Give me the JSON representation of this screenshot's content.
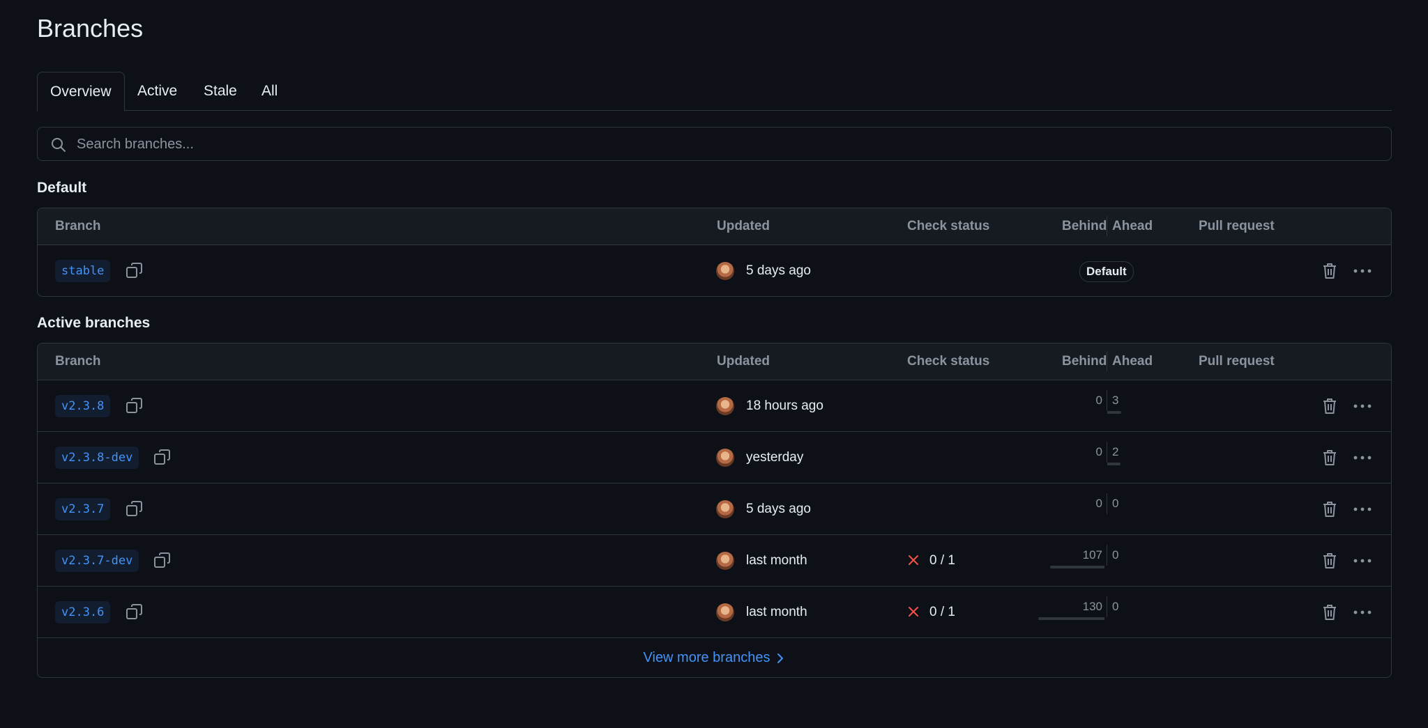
{
  "page": {
    "title": "Branches"
  },
  "tabs": [
    {
      "label": "Overview",
      "selected": true
    },
    {
      "label": "Active",
      "selected": false
    },
    {
      "label": "Stale",
      "selected": false
    },
    {
      "label": "All",
      "selected": false
    }
  ],
  "search": {
    "placeholder": "Search branches..."
  },
  "columns": {
    "branch": "Branch",
    "updated": "Updated",
    "check_status": "Check status",
    "behind": "Behind",
    "ahead": "Ahead",
    "pull_request": "Pull request"
  },
  "default_section": {
    "title": "Default",
    "branch": {
      "name": "stable",
      "updated": "5 days ago",
      "badge": "Default"
    }
  },
  "active_section": {
    "title": "Active branches",
    "branches": [
      {
        "name": "v2.3.8",
        "updated": "18 hours ago",
        "check": "",
        "behind": 0,
        "ahead": 3
      },
      {
        "name": "v2.3.8-dev",
        "updated": "yesterday",
        "check": "",
        "behind": 0,
        "ahead": 2
      },
      {
        "name": "v2.3.7",
        "updated": "5 days ago",
        "check": "",
        "behind": 0,
        "ahead": 0
      },
      {
        "name": "v2.3.7-dev",
        "updated": "last month",
        "check": "0 / 1",
        "behind": 107,
        "ahead": 0
      },
      {
        "name": "v2.3.6",
        "updated": "last month",
        "check": "0 / 1",
        "behind": 130,
        "ahead": 0
      }
    ],
    "view_more": "View more branches"
  },
  "colors": {
    "background": "#0d1117",
    "link": "#4493f8",
    "failure": "#f85149",
    "muted": "#8b949e"
  },
  "icons": {
    "search": "search-icon",
    "copy": "copy-icon",
    "trash": "trash-icon",
    "more": "kebab-horizontal-icon",
    "fail": "x-icon",
    "chevron": "chevron-right-icon"
  }
}
